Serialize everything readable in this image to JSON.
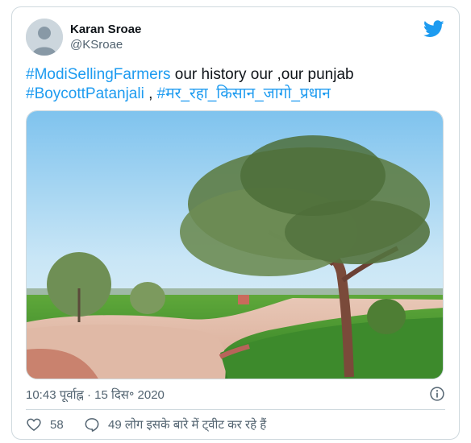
{
  "author": {
    "name": "Karan Sroae",
    "handle": "@KSroae"
  },
  "tweet": {
    "hashtag_1": "#ModiSellingFarmers",
    "text_1": " our history  our ,our punjab",
    "hashtag_2": "#BoycottPatanjali",
    "text_2": " , ",
    "hashtag_3": "#मर_रहा_किसान_जागो_प्रधान"
  },
  "media": {
    "description_icon": "photo"
  },
  "meta": {
    "timestamp": "10:43 पूर्वाह्न · 15 दिस॰ 2020",
    "info_icon": "info-icon"
  },
  "actions": {
    "like_count": "58",
    "talk_text": "49 लोग इसके बारे में ट्वीट कर रहे हैं"
  },
  "colors": {
    "accent": "#1d9bf0",
    "text": "#0f1419",
    "muted": "#536471",
    "border": "#cfd9de"
  }
}
